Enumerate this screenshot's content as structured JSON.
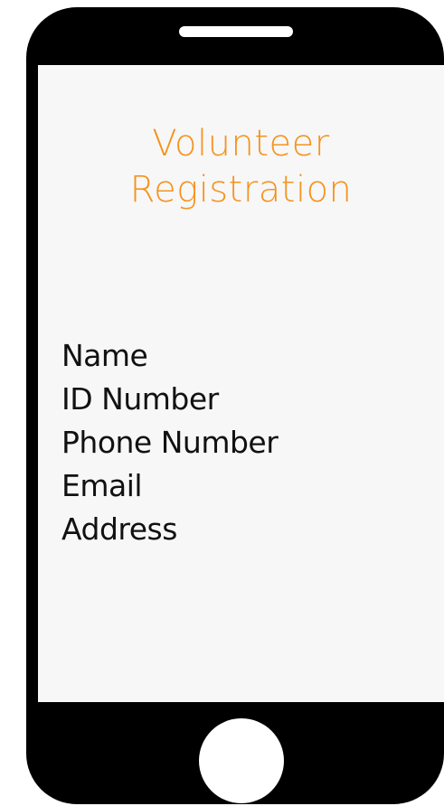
{
  "colors": {
    "phone_body": "#000000",
    "screen": "#f7f7f7",
    "title": "#f5931e",
    "field_text": "#111111"
  },
  "device": {
    "speaker_icon": "speaker-grille-icon",
    "home_button_icon": "home-button-icon"
  },
  "screen": {
    "title": {
      "line1": "Volunteer",
      "line2": "Registration"
    },
    "fields": [
      "Name",
      "ID Number",
      "Phone Number",
      "Email",
      "Address"
    ]
  }
}
